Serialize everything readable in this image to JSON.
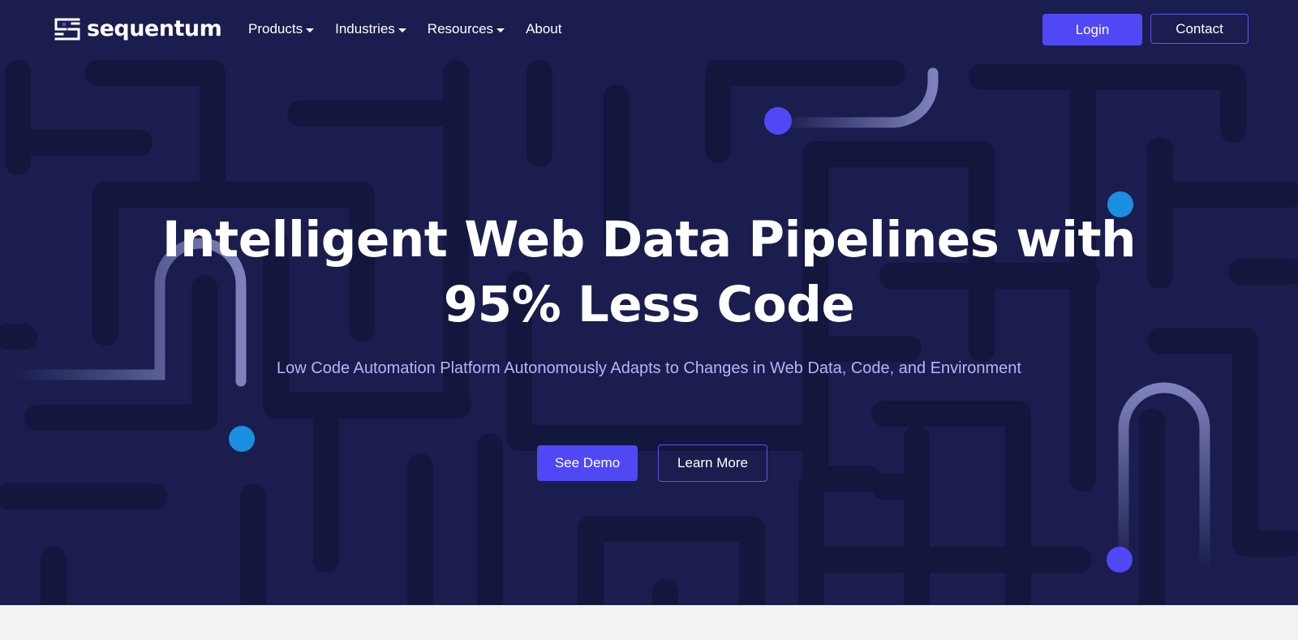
{
  "brand": {
    "name": "sequentum",
    "logo_icon": "sequentum-logo-icon"
  },
  "nav": {
    "items": [
      {
        "label": "Products",
        "has_dropdown": true
      },
      {
        "label": "Industries",
        "has_dropdown": true
      },
      {
        "label": "Resources",
        "has_dropdown": true
      },
      {
        "label": "About",
        "has_dropdown": false
      }
    ],
    "login_label": "Login",
    "contact_label": "Contact"
  },
  "hero": {
    "title_line1": "Intelligent Web Data Pipelines with",
    "title_line2": "95% Less Code",
    "subtitle": "Low Code Automation Platform Autonomously Adapts to Changes in Web Data, Code, and Environment",
    "primary_cta": "See Demo",
    "secondary_cta": "Learn More"
  },
  "colors": {
    "hero_bg": "#1a1d4e",
    "maze_line": "#13163d",
    "accent": "#5048f5",
    "dot_blue": "#1a8fe0",
    "dot_purple": "#5048f5",
    "subtitle": "#b4b6f5",
    "page_bg": "#f2f2f2"
  }
}
